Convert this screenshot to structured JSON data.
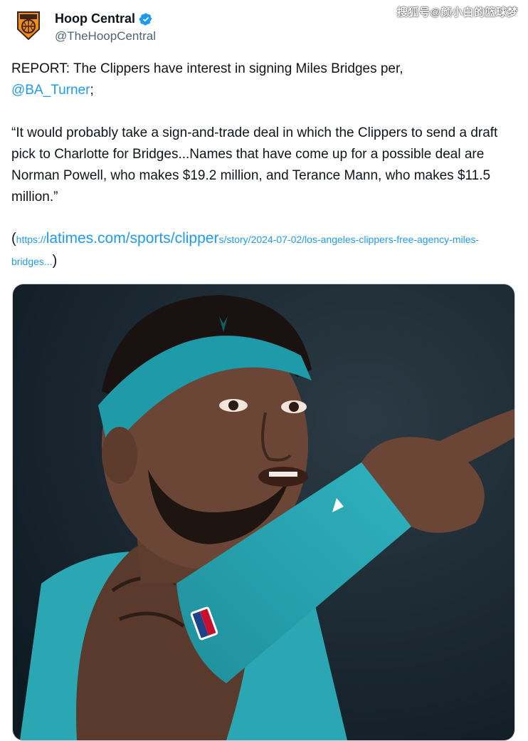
{
  "watermark": "搜狐号@颜小白的篮球梦",
  "account": {
    "display_name": "Hoop Central",
    "handle": "@TheHoopCentral",
    "avatar_icon": "hoop-central-logo-icon",
    "verified_icon": "verified-badge-icon"
  },
  "tweet": {
    "line1_prefix": "REPORT: The Clippers have interest in signing Miles Bridges per,",
    "mention": "@BA_Turner",
    "mention_suffix": ";",
    "quote": "“It would probably take a sign-and-trade deal in which the Clippers to send a draft pick to Charlotte for Bridges...Names that have come up for a possible deal are Norman Powell, who makes $19.2 million, and Terance Mann, who makes $11.5 million.”",
    "link_open": "(",
    "link_large": "https://latimes.com/sports/clipper",
    "link_large_parts": [
      "https://",
      "latimes.com/sports/clipper"
    ],
    "link_small": "s/story/2024-07-02/los-angeles-clippers-free-agency-miles-bridges...",
    "link_close": ")"
  },
  "media": {
    "alt": "photo",
    "colors": {
      "background": "#1c2a33",
      "headband": "#1f9aa8",
      "skin": "#6b4636",
      "jersey": "#2aa7b3"
    }
  },
  "colors": {
    "link": "#1d9bf0",
    "text": "#0f1419",
    "secondary": "#536471",
    "verified": "#1d9bf0"
  }
}
